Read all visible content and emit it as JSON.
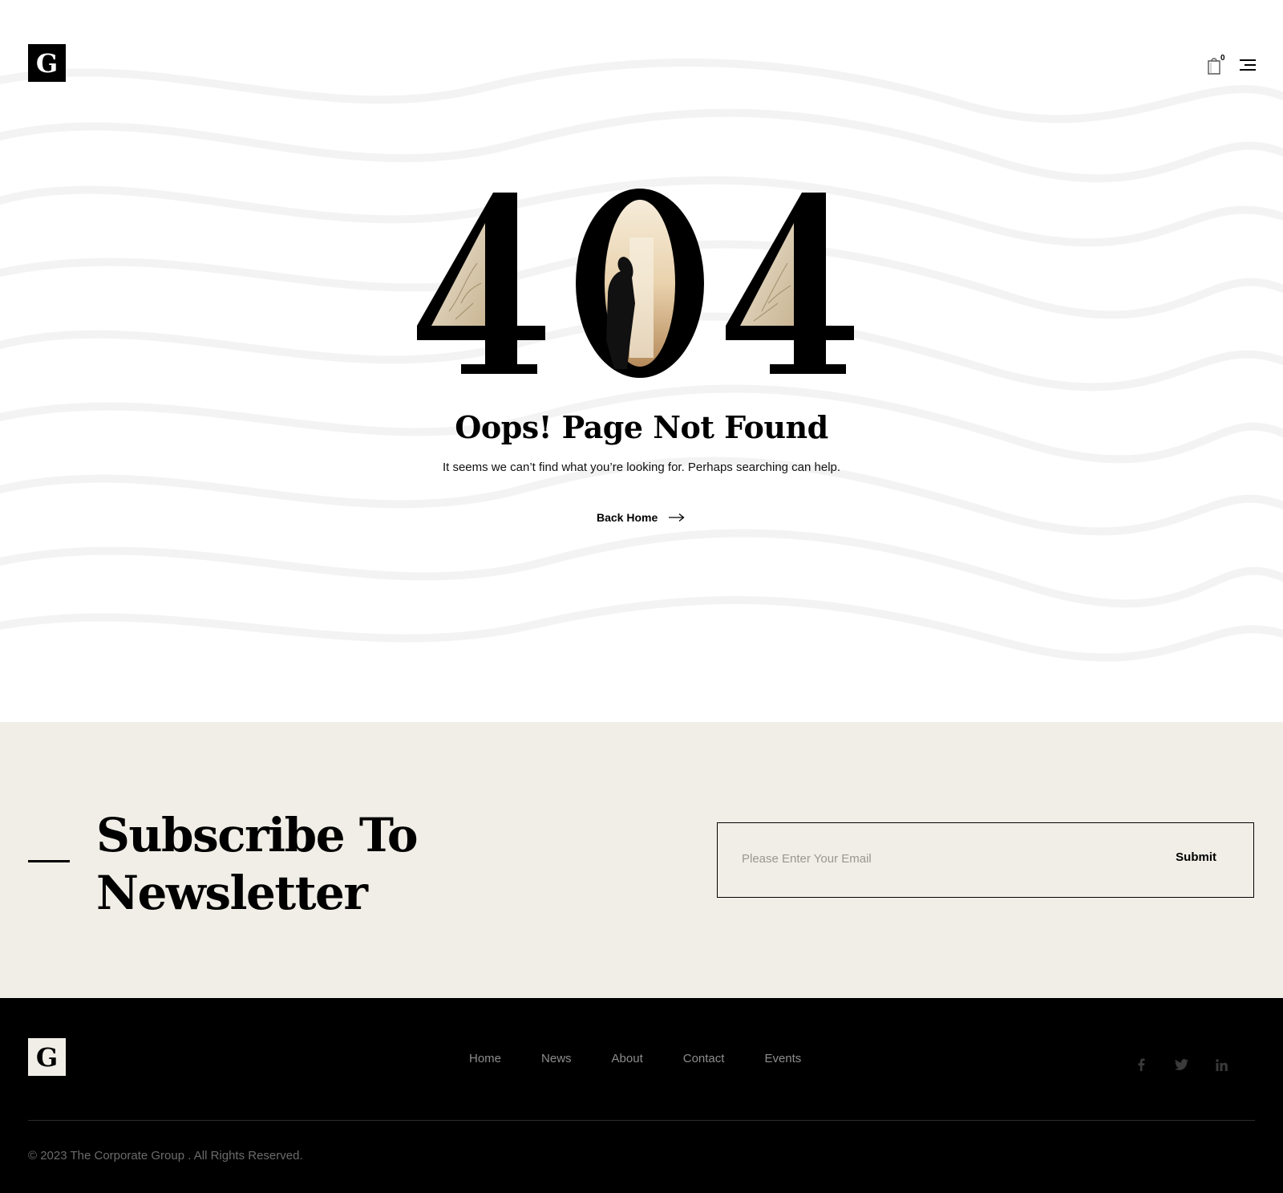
{
  "header": {
    "logo_letter": "G",
    "cart_count": "0"
  },
  "error": {
    "code_digits": [
      "4",
      "0",
      "4"
    ],
    "title": "Oops! Page Not Found",
    "message": "It seems we can’t find what you’re looking for. Perhaps searching can help.",
    "back_home_label": "Back Home"
  },
  "newsletter": {
    "title_line1": "Subscribe To",
    "title_line2": "Newsletter",
    "email_placeholder": "Please Enter Your Email",
    "submit_label": "Submit"
  },
  "footer": {
    "logo_letter": "G",
    "nav": [
      {
        "label": "Home"
      },
      {
        "label": "News"
      },
      {
        "label": "About"
      },
      {
        "label": "Contact"
      },
      {
        "label": "Events"
      }
    ],
    "social_icons": [
      "facebook-icon",
      "twitter-icon",
      "linkedin-icon"
    ],
    "copyright": "© 2023 The Corporate Group . All Rights Reserved."
  },
  "colors": {
    "newsletter_bg": "#f1eee7",
    "footer_bg": "#000000",
    "footer_text": "#8d8d8d",
    "accent": "#000000"
  }
}
